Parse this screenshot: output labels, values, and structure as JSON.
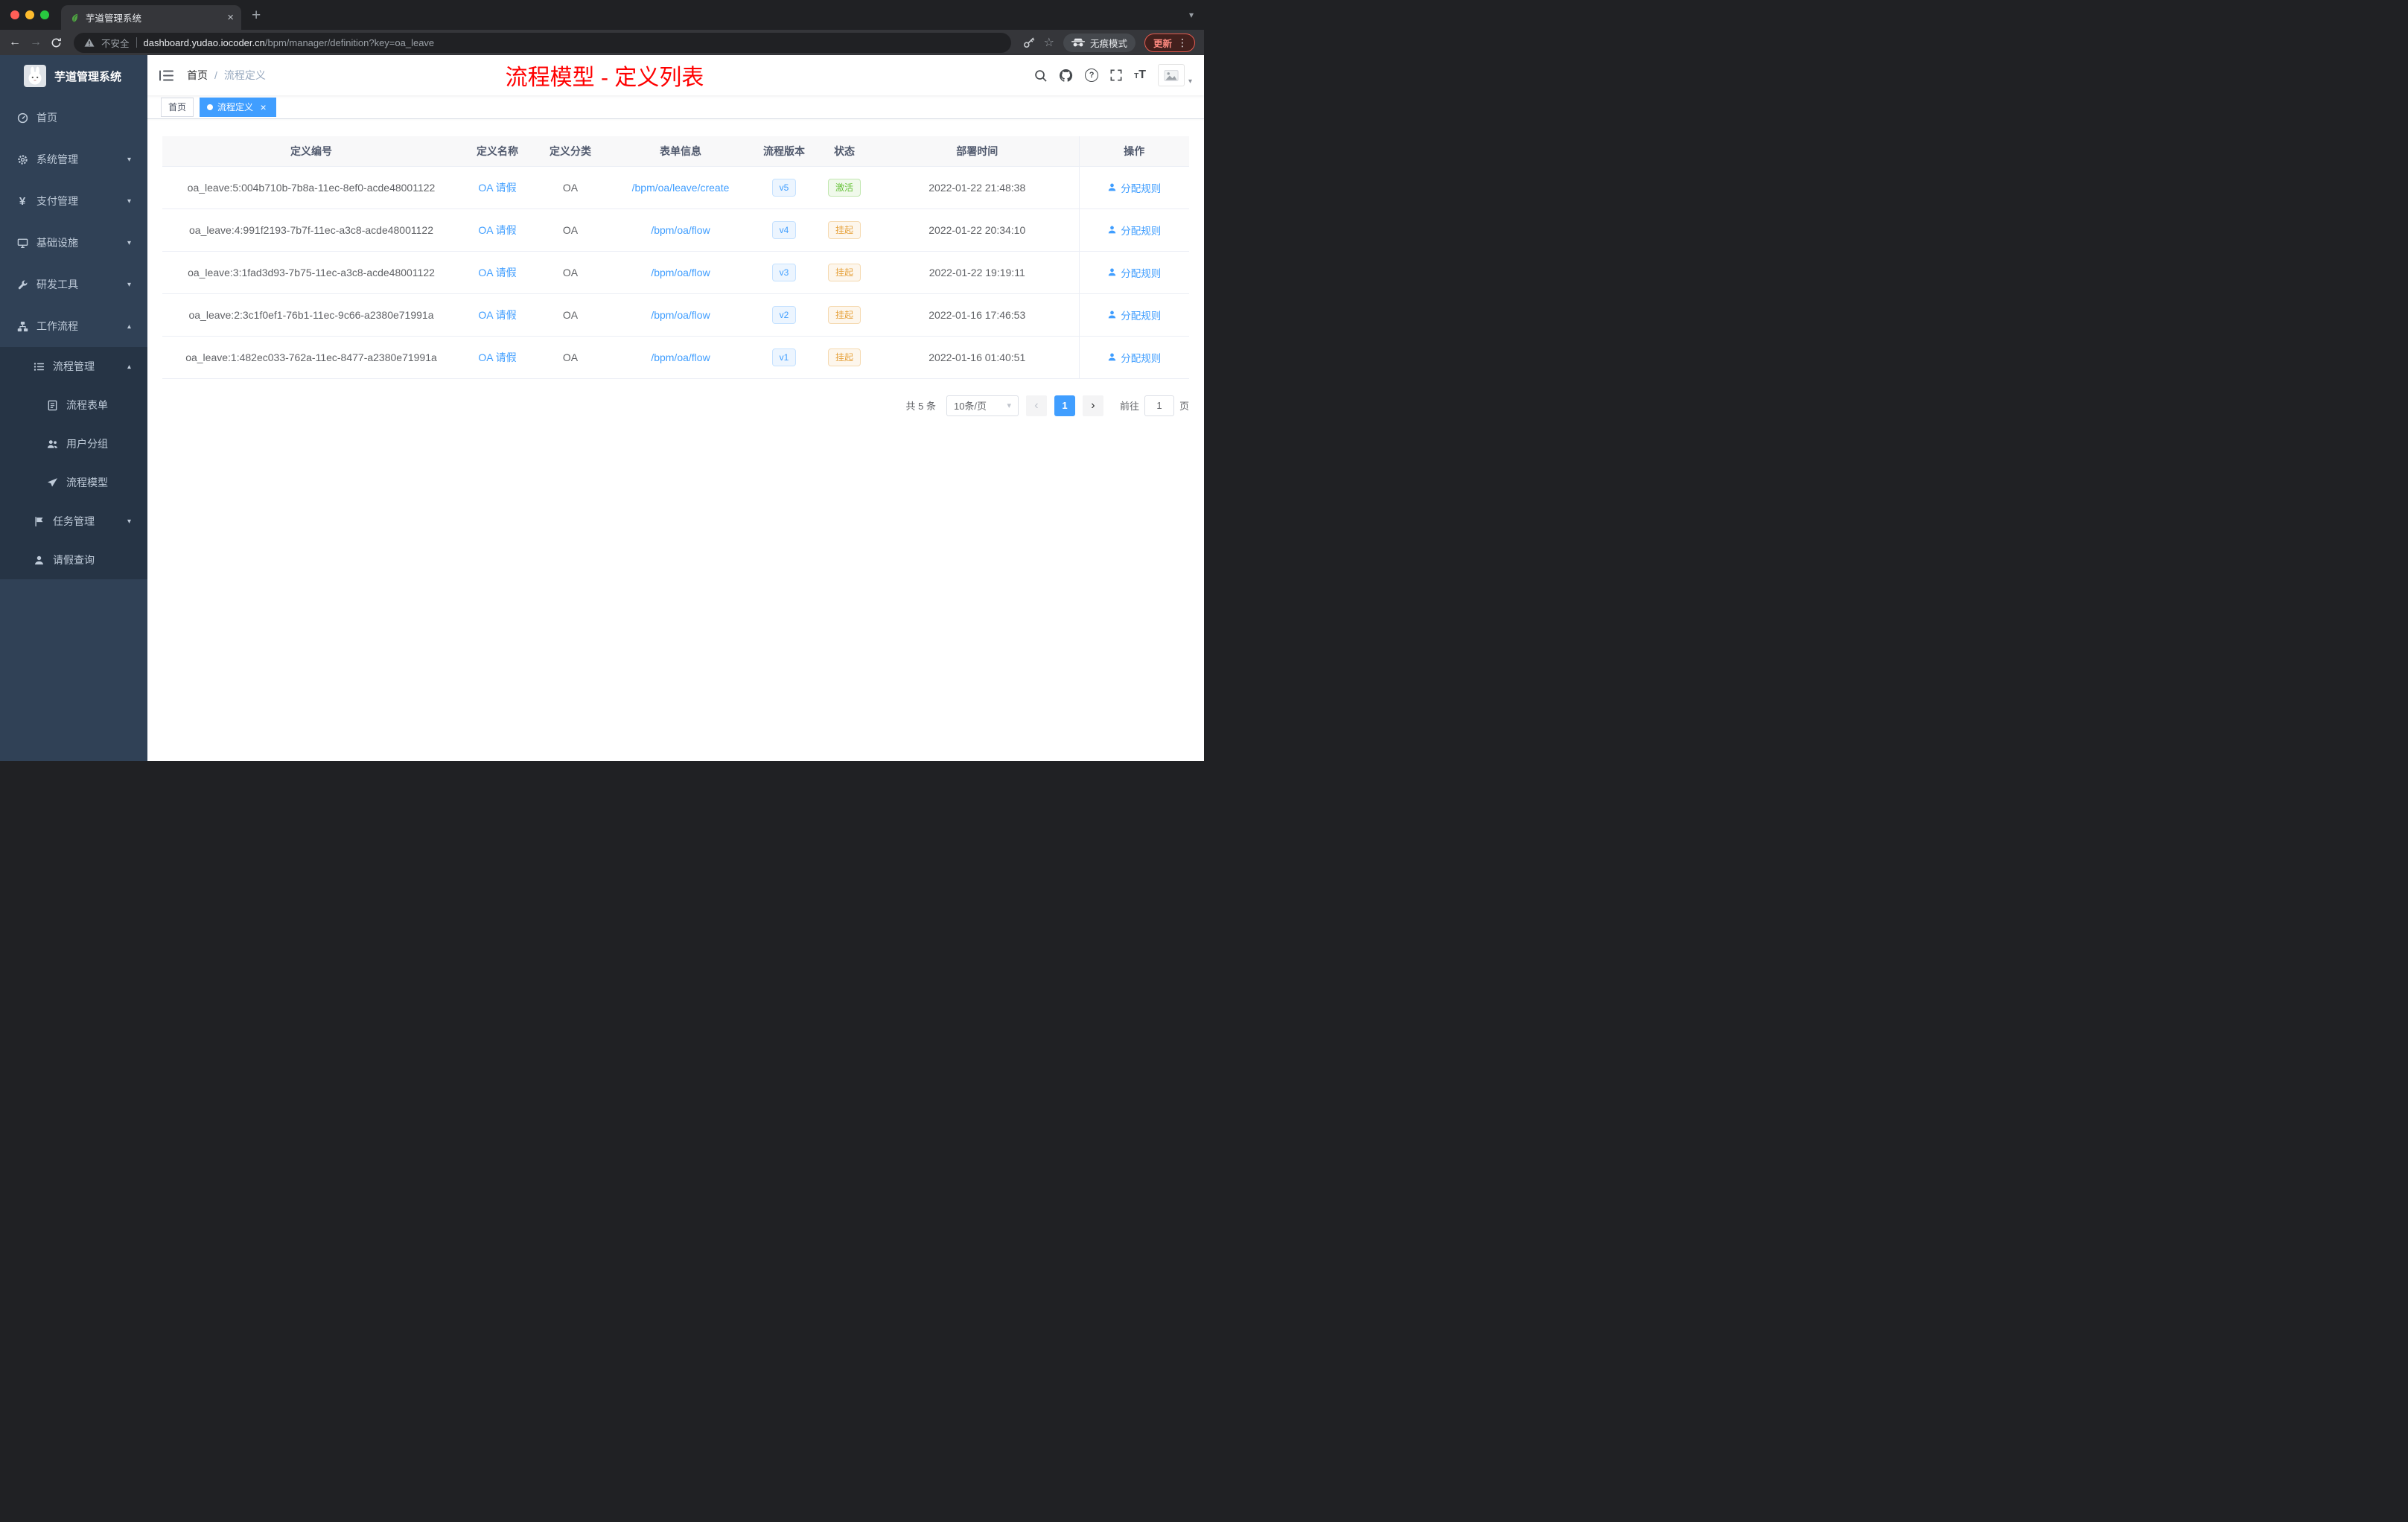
{
  "browser": {
    "tab_title": "芋道管理系统",
    "security_label": "不安全",
    "url_host": "dashboard.yudao.iocoder.cn",
    "url_path": "/bpm/manager/definition?key=oa_leave",
    "incognito_label": "无痕模式",
    "update_label": "更新"
  },
  "sidebar": {
    "logo_title": "芋道管理系统",
    "items": [
      {
        "label": "首页"
      },
      {
        "label": "系统管理"
      },
      {
        "label": "支付管理"
      },
      {
        "label": "基础设施"
      },
      {
        "label": "研发工具"
      },
      {
        "label": "工作流程"
      },
      {
        "label": "流程管理"
      },
      {
        "label": "流程表单"
      },
      {
        "label": "用户分组"
      },
      {
        "label": "流程模型"
      },
      {
        "label": "任务管理"
      },
      {
        "label": "请假查询"
      }
    ]
  },
  "navbar": {
    "breadcrumb_home": "首页",
    "breadcrumb_current": "流程定义",
    "annotation": "流程模型 - 定义列表"
  },
  "tags": {
    "home": "首页",
    "current": "流程定义"
  },
  "table": {
    "columns": [
      "定义编号",
      "定义名称",
      "定义分类",
      "表单信息",
      "流程版本",
      "状态",
      "部署时间",
      "操作"
    ],
    "rows": [
      {
        "id": "oa_leave:5:004b710b-7b8a-11ec-8ef0-acde48001122",
        "name": "OA 请假",
        "category": "OA",
        "form": "/bpm/oa/leave/create",
        "version": "v5",
        "status": "激活",
        "time": "2022-01-22 21:48:38",
        "action": "分配规则"
      },
      {
        "id": "oa_leave:4:991f2193-7b7f-11ec-a3c8-acde48001122",
        "name": "OA 请假",
        "category": "OA",
        "form": "/bpm/oa/flow",
        "version": "v4",
        "status": "挂起",
        "time": "2022-01-22 20:34:10",
        "action": "分配规则"
      },
      {
        "id": "oa_leave:3:1fad3d93-7b75-11ec-a3c8-acde48001122",
        "name": "OA 请假",
        "category": "OA",
        "form": "/bpm/oa/flow",
        "version": "v3",
        "status": "挂起",
        "time": "2022-01-22 19:19:11",
        "action": "分配规则"
      },
      {
        "id": "oa_leave:2:3c1f0ef1-76b1-11ec-9c66-a2380e71991a",
        "name": "OA 请假",
        "category": "OA",
        "form": "/bpm/oa/flow",
        "version": "v2",
        "status": "挂起",
        "time": "2022-01-16 17:46:53",
        "action": "分配规则"
      },
      {
        "id": "oa_leave:1:482ec033-762a-11ec-8477-a2380e71991a",
        "name": "OA 请假",
        "category": "OA",
        "form": "/bpm/oa/flow",
        "version": "v1",
        "status": "挂起",
        "time": "2022-01-16 01:40:51",
        "action": "分配规则"
      }
    ]
  },
  "pagination": {
    "total": "共 5 条",
    "page_size": "10条/页",
    "page": "1",
    "goto_label": "前往",
    "goto_value": "1",
    "goto_suffix": "页"
  },
  "colors": {
    "primary": "#409eff",
    "success": "#67c23a",
    "warning": "#e6a23c",
    "annotation_red": "#fe0000",
    "sidebar_bg": "#304156"
  }
}
